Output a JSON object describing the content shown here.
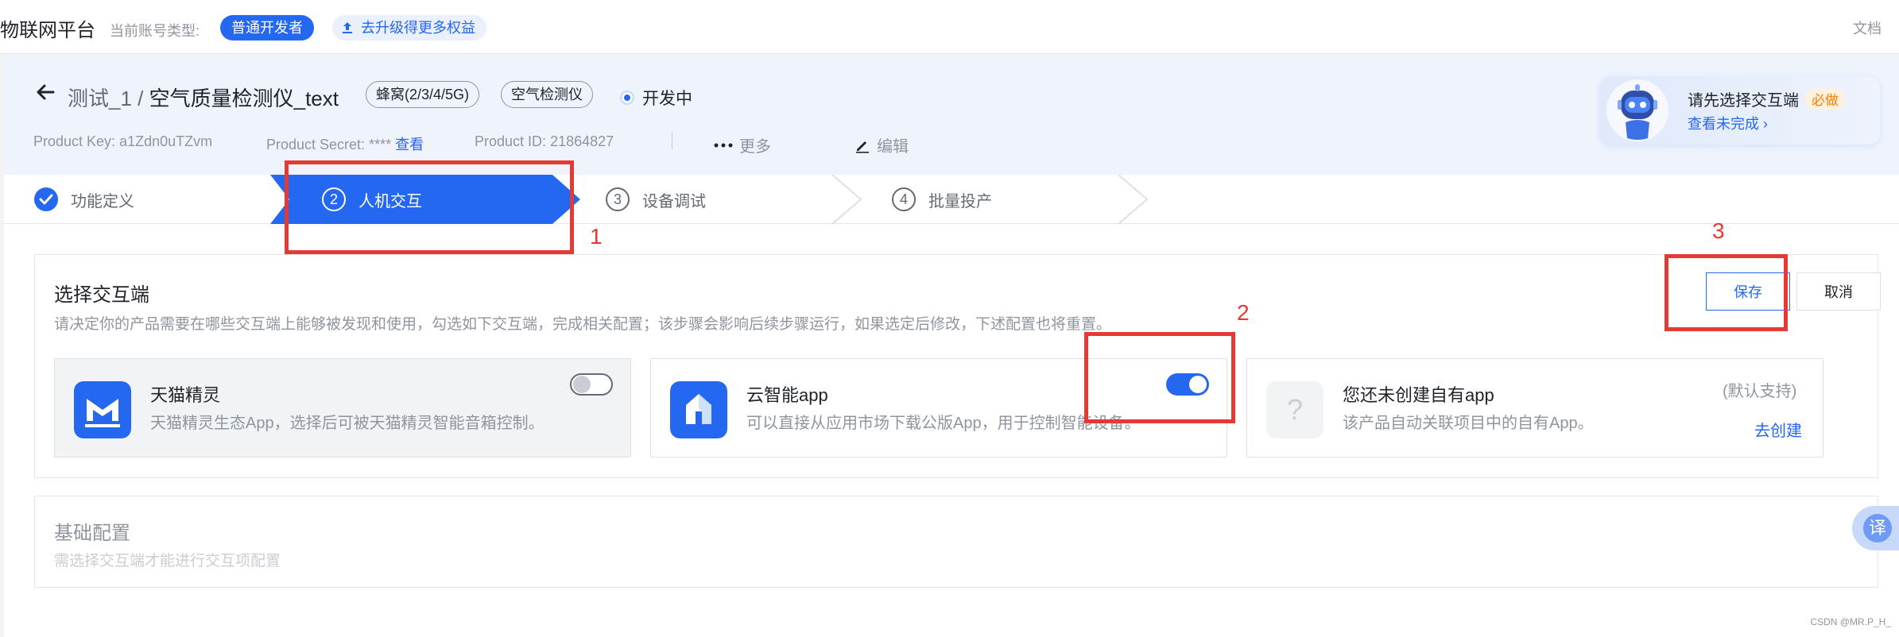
{
  "topbar": {
    "brand": "物联网平台",
    "account_type_label": "当前账号类型:",
    "account_type_badge": "普通开发者",
    "upgrade_label": "去升级得更多权益",
    "docs_label": "文档"
  },
  "header": {
    "breadcrumb_parent": "测试_1 /",
    "product_name": "空气质量检测仪_text",
    "tags": [
      "蜂窝(2/3/4/5G)",
      "空气检测仪"
    ],
    "status": "开发中",
    "product_key_label": "Product Key:",
    "product_key_value": "a1Zdn0uTZvm",
    "product_secret_label": "Product Secret:",
    "product_secret_value": "****",
    "product_secret_link": "查看",
    "product_id_label": "Product ID:",
    "product_id_value": "21864827",
    "more_label": "更多",
    "edit_label": "编辑",
    "hint": {
      "title": "请先选择交互端",
      "must_badge": "必做",
      "link": "查看未完成"
    }
  },
  "steps": [
    {
      "index": "✓",
      "label": "功能定义",
      "state": "done"
    },
    {
      "index": "2",
      "label": "人机交互",
      "state": "active"
    },
    {
      "index": "3",
      "label": "设备调试",
      "state": "todo"
    },
    {
      "index": "4",
      "label": "批量投产",
      "state": "todo"
    }
  ],
  "select_terminal": {
    "title": "选择交互端",
    "description": "请决定你的产品需要在哪些交互端上能够被发现和使用，勾选如下交互端，完成相关配置；该步骤会影响后续步骤运行，如果选定后修改，下述配置也将重置。",
    "save_label": "保存",
    "cancel_label": "取消",
    "options": [
      {
        "name": "天猫精灵",
        "desc": "天猫精灵生态App，选择后可被天猫精灵智能音箱控制。",
        "enabled": false,
        "icon": "tmall-genie-icon"
      },
      {
        "name": "云智能app",
        "desc": "可以直接从应用市场下载公版App，用于控制智能设备。",
        "enabled": true,
        "icon": "cloud-app-icon"
      },
      {
        "name": "您还未创建自有app",
        "desc": "该产品自动关联项目中的自有App。",
        "default_note": "(默认支持)",
        "create_link": "去创建",
        "icon": "question-icon"
      }
    ]
  },
  "basic_config": {
    "title": "基础配置",
    "description": "需选择交互端才能进行交互项配置"
  },
  "translate_label": "译",
  "watermark": "CSDN @MR.P_H_",
  "annotations": [
    "1",
    "2",
    "3"
  ],
  "colors": {
    "accent": "#2468f2",
    "annotation": "#e53935",
    "must": "#ff7d00"
  }
}
